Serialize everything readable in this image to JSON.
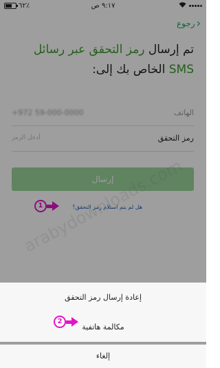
{
  "status_bar": {
    "battery": "٦٢٪",
    "time": "٩:١٧ ص"
  },
  "nav": {
    "back_label": "رجوع"
  },
  "heading": {
    "part1": "تم إرسال ",
    "highlight": "رمز التحقق عبر رسائل SMS",
    "part2": " الخاص بك إلى:"
  },
  "phone_field": {
    "label": "الهاتف",
    "value": "+972 59-000-0000"
  },
  "code_field": {
    "label": "رمز التحقق",
    "placeholder": "أدخل الرمز"
  },
  "send_button": {
    "label": "إرسال"
  },
  "help_link": {
    "label": "هل لم يتم استلام رمز التحقق؟"
  },
  "watermark": {
    "text": "arabydownloads.com"
  },
  "action_sheet": {
    "resend_label": "إعادة إرسال رمز التحقق",
    "call_label": "مكالمة هاتفية",
    "cancel_label": "إلغاء"
  },
  "markers": {
    "one": "1",
    "two": "2",
    "color": "#e215c7"
  },
  "colors": {
    "accent_green": "#3a9a2a",
    "nav_green": "#1aa260",
    "link_blue": "#2a63b8"
  },
  "battery_level": 0.62
}
